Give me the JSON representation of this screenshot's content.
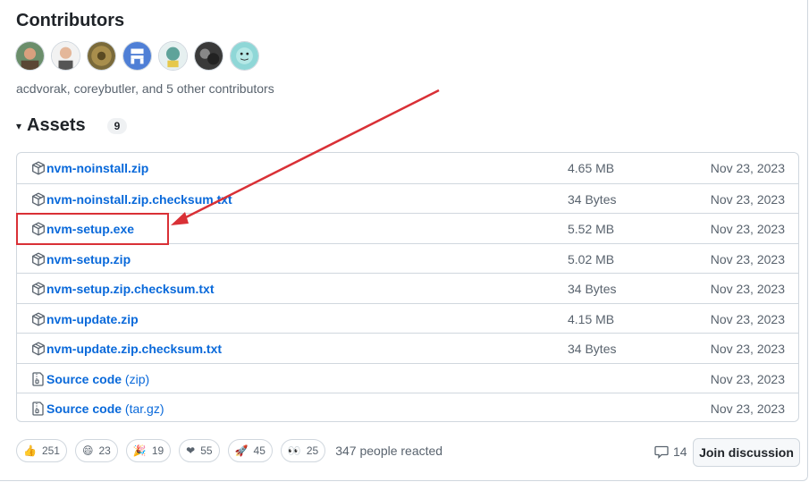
{
  "contributors": {
    "title": "Contributors",
    "summary": "acdvorak, coreybutler, and 5 other contributors",
    "avatars": [
      "avatar-1",
      "avatar-2",
      "avatar-3",
      "avatar-4",
      "avatar-5",
      "avatar-6",
      "avatar-7"
    ]
  },
  "assets": {
    "title": "Assets",
    "count": "9",
    "caret": "▾",
    "rows": [
      {
        "name": "nvm-noinstall.zip",
        "ext": "",
        "size": "4.65 MB",
        "date": "Nov 23, 2023",
        "icon": "package-icon"
      },
      {
        "name": "nvm-noinstall.zip.checksum.txt",
        "ext": "",
        "size": "34 Bytes",
        "date": "Nov 23, 2023",
        "icon": "package-icon"
      },
      {
        "name": "nvm-setup.exe",
        "ext": "",
        "size": "5.52 MB",
        "date": "Nov 23, 2023",
        "icon": "package-icon"
      },
      {
        "name": "nvm-setup.zip",
        "ext": "",
        "size": "5.02 MB",
        "date": "Nov 23, 2023",
        "icon": "package-icon"
      },
      {
        "name": "nvm-setup.zip.checksum.txt",
        "ext": "",
        "size": "34 Bytes",
        "date": "Nov 23, 2023",
        "icon": "package-icon"
      },
      {
        "name": "nvm-update.zip",
        "ext": "",
        "size": "4.15 MB",
        "date": "Nov 23, 2023",
        "icon": "package-icon"
      },
      {
        "name": "nvm-update.zip.checksum.txt",
        "ext": "",
        "size": "34 Bytes",
        "date": "Nov 23, 2023",
        "icon": "package-icon"
      },
      {
        "name": "Source code",
        "ext": " (zip)",
        "size": "",
        "date": "Nov 23, 2023",
        "icon": "file-zip-icon"
      },
      {
        "name": "Source code",
        "ext": " (tar.gz)",
        "size": "",
        "date": "Nov 23, 2023",
        "icon": "file-zip-icon"
      }
    ]
  },
  "reactions": {
    "items": [
      {
        "emoji": "👍",
        "name": "thumbs-up",
        "count": "251"
      },
      {
        "emoji": "😄",
        "name": "laugh",
        "count": "23"
      },
      {
        "emoji": "🎉",
        "name": "hooray",
        "count": "19"
      },
      {
        "emoji": "❤",
        "name": "heart",
        "count": "55"
      },
      {
        "emoji": "🚀",
        "name": "rocket",
        "count": "45"
      },
      {
        "emoji": "👀",
        "name": "eyes",
        "count": "25"
      }
    ],
    "summary": "347 people reacted"
  },
  "discussion": {
    "comment_count": "14",
    "join_label": "Join discussion"
  },
  "colors": {
    "link": "#0969da",
    "annotation": "#d93036"
  }
}
